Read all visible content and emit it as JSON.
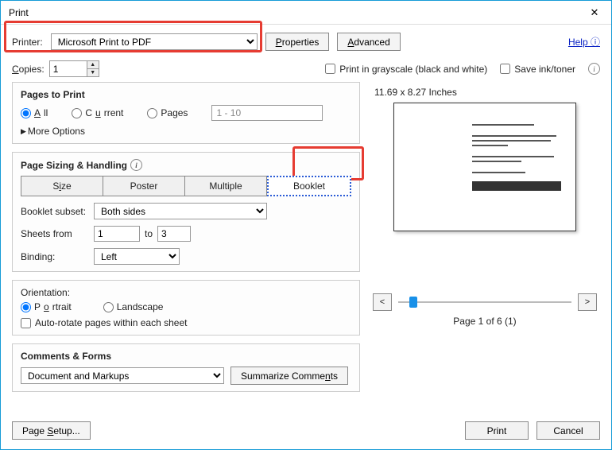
{
  "window": {
    "title": "Print"
  },
  "top": {
    "printer_label": "Printer:",
    "printer_value": "Microsoft Print to PDF",
    "properties_btn": "Properties",
    "advanced_btn": "Advanced",
    "help": "Help",
    "copies_label": "Copies:",
    "copies_value": "1",
    "grayscale": "Print in grayscale (black and white)",
    "save_ink": "Save ink/toner"
  },
  "pages": {
    "heading": "Pages to Print",
    "all": "All",
    "current": "Current",
    "pages": "Pages",
    "range": "1 - 10",
    "more": "More Options"
  },
  "sizing": {
    "heading": "Page Sizing & Handling",
    "size": "Size",
    "poster": "Poster",
    "multiple": "Multiple",
    "booklet": "Booklet",
    "subset_label": "Booklet subset:",
    "subset_value": "Both sides",
    "sheets_from_label": "Sheets from",
    "sheets_from": "1",
    "to_label": "to",
    "sheets_to": "3",
    "binding_label": "Binding:",
    "binding_value": "Left"
  },
  "orient": {
    "heading": "Orientation:",
    "portrait": "Portrait",
    "landscape": "Landscape",
    "autorotate": "Auto-rotate pages within each sheet"
  },
  "comments": {
    "heading": "Comments & Forms",
    "value": "Document and Markups",
    "summarize": "Summarize Comments"
  },
  "preview": {
    "dims": "11.69 x 8.27 Inches",
    "nav_prev": "<",
    "nav_next": ">",
    "page_label": "Page 1 of 6 (1)"
  },
  "footer": {
    "page_setup": "Page Setup...",
    "print": "Print",
    "cancel": "Cancel"
  }
}
